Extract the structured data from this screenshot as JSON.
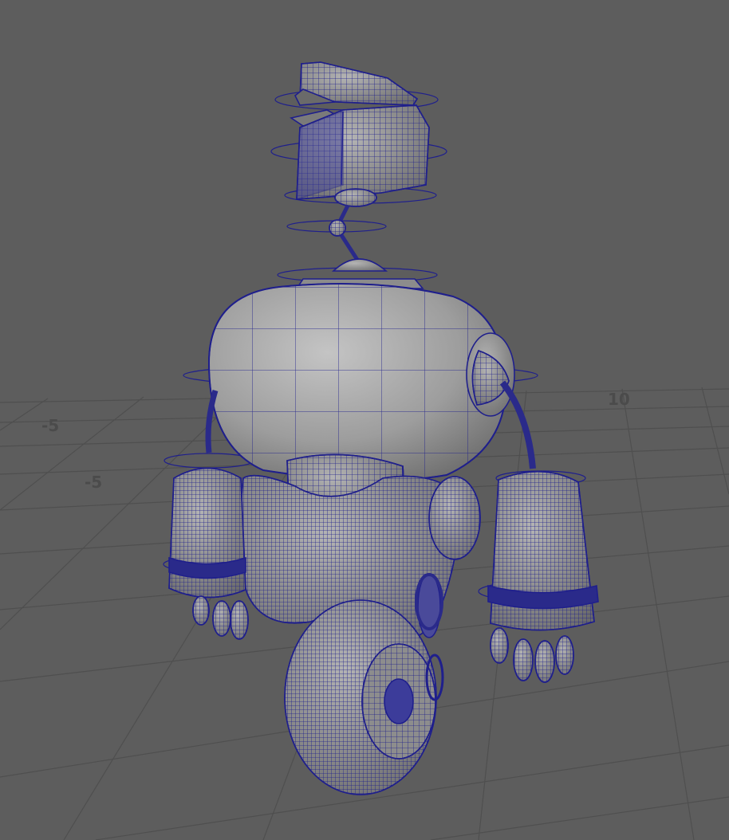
{
  "viewport": {
    "background": "#5d5d5d",
    "wire_color": "#1f1f8c",
    "mesh_color": "#a4a4a4",
    "grid_labels": [
      {
        "id": "grid-label-10",
        "text": "10"
      },
      {
        "id": "grid-label-neg5-a",
        "text": "-5"
      },
      {
        "id": "grid-label-neg5-b",
        "text": "-5"
      }
    ]
  }
}
